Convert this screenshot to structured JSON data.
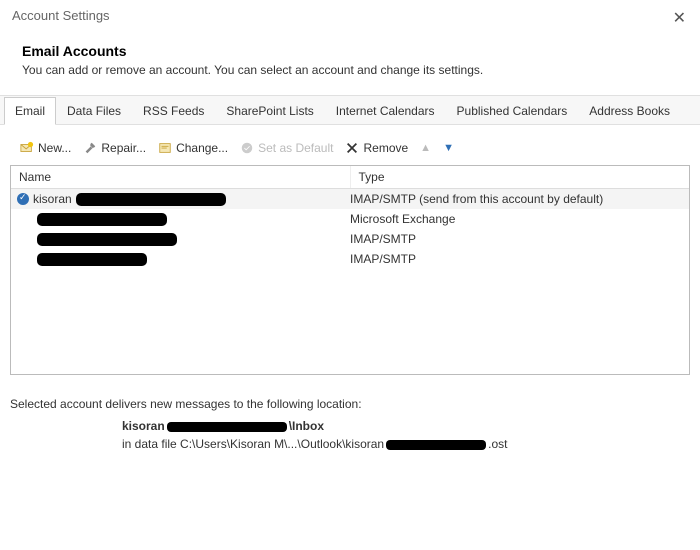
{
  "header": {
    "title": "Account Settings"
  },
  "intro": {
    "heading": "Email Accounts",
    "desc": "You can add or remove an account. You can select an account and change its settings."
  },
  "tabs": [
    {
      "label": "Email",
      "active": true
    },
    {
      "label": "Data Files"
    },
    {
      "label": "RSS Feeds"
    },
    {
      "label": "SharePoint Lists"
    },
    {
      "label": "Internet Calendars"
    },
    {
      "label": "Published Calendars"
    },
    {
      "label": "Address Books"
    }
  ],
  "toolbar": {
    "new": "New...",
    "repair": "Repair...",
    "change": "Change...",
    "setdefault": "Set as Default",
    "remove": "Remove"
  },
  "table": {
    "col_name": "Name",
    "col_type": "Type",
    "rows": [
      {
        "name": "kisoran",
        "type": "IMAP/SMTP (send from this account by default)",
        "default": true
      },
      {
        "name": "",
        "type": "Microsoft Exchange"
      },
      {
        "name": "",
        "type": "IMAP/SMTP"
      },
      {
        "name": "",
        "type": "IMAP/SMTP"
      }
    ]
  },
  "status": {
    "intro": "Selected account delivers new messages to the following location:",
    "path_prefix": "kisoran",
    "path_suffix": "\\Inbox",
    "file_prefix": "in data file C:\\Users\\Kisoran M\\...\\Outlook\\kisoran",
    "file_suffix": ".ost"
  }
}
